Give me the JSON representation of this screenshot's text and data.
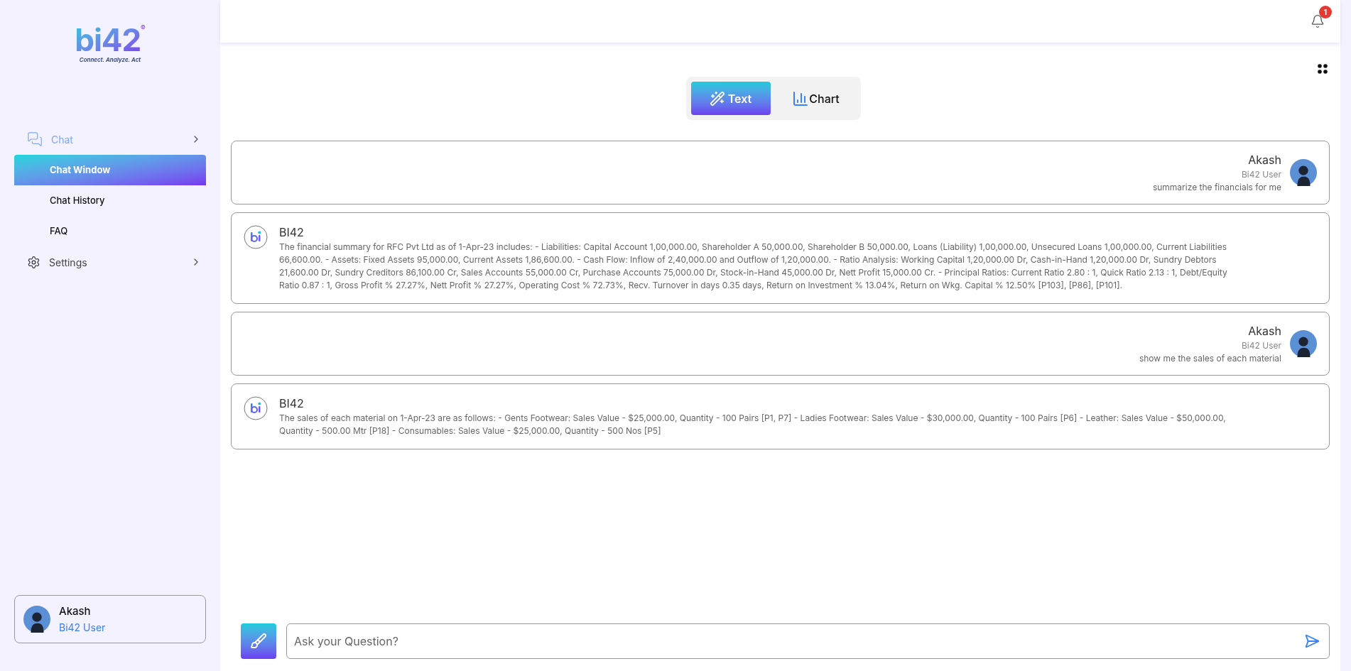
{
  "sidebar": {
    "logo": {
      "text": "bi42",
      "mark": "®",
      "tagline": "Connect. Analyze. Act"
    },
    "nav": [
      {
        "label": "Chat",
        "kind": "chat",
        "children": [
          {
            "label": "Chat Window",
            "selected": true
          },
          {
            "label": "Chat History",
            "selected": false
          },
          {
            "label": "FAQ",
            "selected": false
          }
        ]
      },
      {
        "label": "Settings",
        "kind": "settings"
      }
    ],
    "user": {
      "name": "Akash",
      "role": "Bi42 User"
    }
  },
  "header": {
    "notification_count": "1"
  },
  "mode_tabs": [
    {
      "label": "Text",
      "kind": "wand",
      "selected": true
    },
    {
      "label": "Chart",
      "kind": "chart",
      "selected": false
    }
  ],
  "messages": [
    {
      "kind": "user",
      "name": "Akash",
      "role": "Bi42 User",
      "text": "summarize the financials for me"
    },
    {
      "kind": "bot",
      "name": "BI42",
      "text": "The financial summary for RFC Pvt Ltd as of 1-Apr-23 includes: - Liabilities: Capital Account 1,00,000.00, Shareholder A 50,000.00, Shareholder B 50,000.00, Loans (Liability) 1,00,000.00, Unsecured Loans 1,00,000.00, Current Liabilities 66,600.00. - Assets: Fixed Assets 95,000.00, Current Assets 1,86,600.00. - Cash Flow: Inflow of 2,40,000.00 and Outflow of 1,20,000.00. - Ratio Analysis: Working Capital 1,20,000.00 Dr, Cash-in-Hand 1,20,000.00 Dr, Sundry Debtors 21,600.00 Dr, Sundry Creditors 86,100.00 Cr, Sales Accounts 55,000.00 Cr, Purchase Accounts 75,000.00 Dr, Stock-in-Hand 45,000.00 Dr, Nett Profit 15,000.00 Cr. - Principal Ratios: Current Ratio 2.80 : 1, Quick Ratio 2.13 : 1, Debt/Equity Ratio 0.87 : 1, Gross Profit % 27.27%, Nett Profit % 27.27%, Operating Cost % 72.73%, Recv. Turnover in days 0.35 days, Return on Investment % 13.04%, Return on Wkg. Capital % 12.50% [P103], [P86], [P101]."
    },
    {
      "kind": "user",
      "name": "Akash",
      "role": "Bi42 User",
      "text": "show me the sales of each material"
    },
    {
      "kind": "bot",
      "name": "BI42",
      "text": "The sales of each material on 1-Apr-23 are as follows: - Gents Footwear: Sales Value - $25,000.00, Quantity - 100 Pairs [P1, P7] - Ladies Footwear: Sales Value - $30,000.00, Quantity - 100 Pairs [P6] - Leather: Sales Value - $50,000.00, Quantity - 500.00 Mtr [P18] - Consumables: Sales Value - $25,000.00, Quantity - 500 Nos [P5]"
    }
  ],
  "composer": {
    "placeholder": "Ask your Question?"
  }
}
